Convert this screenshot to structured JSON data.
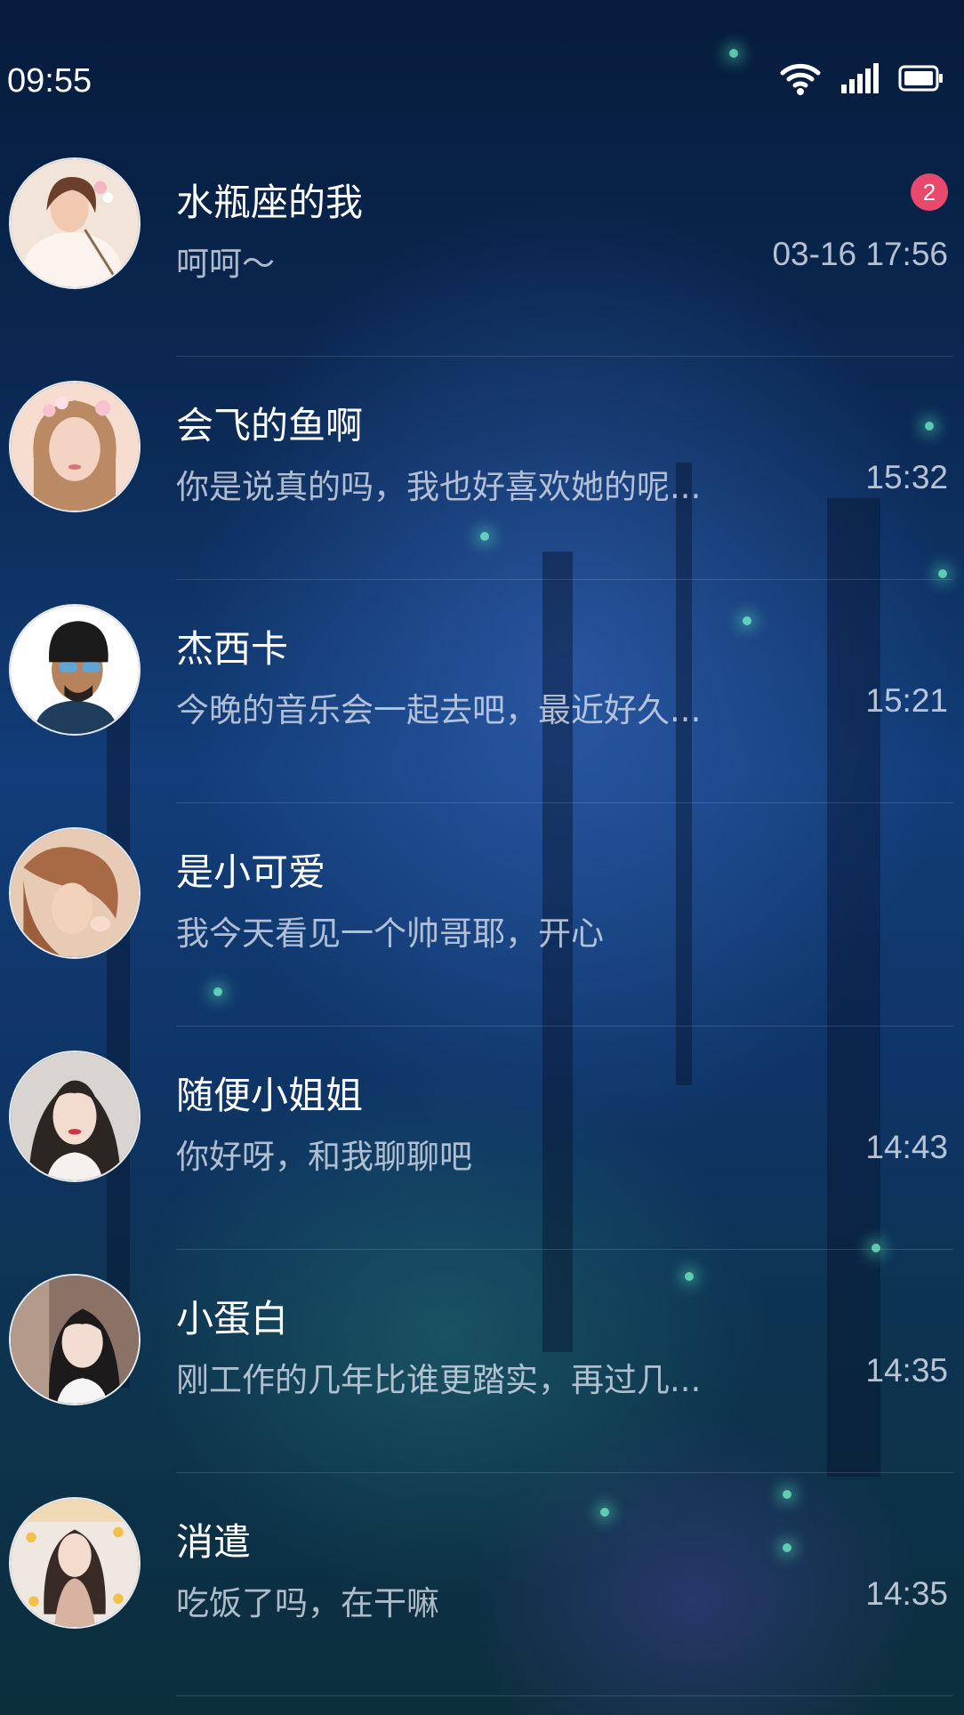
{
  "status_bar": {
    "time": "09:55",
    "icons": [
      "wifi-icon",
      "signal-icon",
      "battery-icon"
    ]
  },
  "conversations": [
    {
      "name": "水瓶座的我",
      "preview": "呵呵～",
      "time": "03-16 17:56",
      "unread": "2",
      "avatar": "avatar-photo-1"
    },
    {
      "name": "会飞的鱼啊",
      "preview": "你是说真的吗，我也好喜欢她的呢...",
      "time": "15:32",
      "avatar": "avatar-photo-2"
    },
    {
      "name": "杰西卡",
      "preview": "今晚的音乐会一起去吧，最近好久...",
      "time": "15:21",
      "avatar": "avatar-photo-3"
    },
    {
      "name": "是小可爱",
      "preview": "我今天看见一个帅哥耶，开心",
      "time": "",
      "avatar": "avatar-photo-4"
    },
    {
      "name": "随便小姐姐",
      "preview": "你好呀，和我聊聊吧",
      "time": "14:43",
      "avatar": "avatar-photo-5"
    },
    {
      "name": "小蛋白",
      "preview": "刚工作的几年比谁更踏实，再过几...",
      "time": "14:35",
      "avatar": "avatar-photo-6"
    },
    {
      "name": "消遣",
      "preview": "吃饭了吗，在干嘛",
      "time": "14:35",
      "avatar": "avatar-photo-7"
    }
  ],
  "colors": {
    "badge": "#e8496d",
    "text_primary": "#ffffff",
    "text_secondary": "#dce4f0"
  }
}
